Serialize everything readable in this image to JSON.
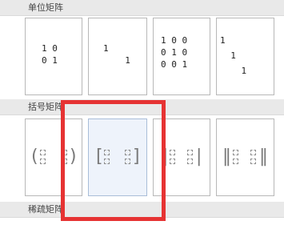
{
  "sections": {
    "identity": {
      "title": "单位矩阵"
    },
    "bracket": {
      "title": "括号矩阵"
    },
    "sparse": {
      "title": "稀疏矩阵"
    }
  },
  "identity_cells": [
    {
      "rows": [
        "1 0",
        "0 1"
      ]
    },
    {
      "rows": [
        "1  ",
        "  1"
      ]
    },
    {
      "rows": [
        "1 0 0",
        "0 1 0",
        "0 0 1"
      ]
    },
    {
      "rows": [
        "1    ",
        "  1  ",
        "    1"
      ]
    }
  ],
  "bracket_cells": [
    {
      "left": "(",
      "right": ")"
    },
    {
      "left": "[",
      "right": "]"
    },
    {
      "left": "|",
      "right": "|"
    },
    {
      "left": "‖",
      "right": "‖"
    }
  ],
  "colors": {
    "highlight": "#e63333",
    "header_bg": "#e9e9e9",
    "selected_bg": "#eef3fb"
  }
}
